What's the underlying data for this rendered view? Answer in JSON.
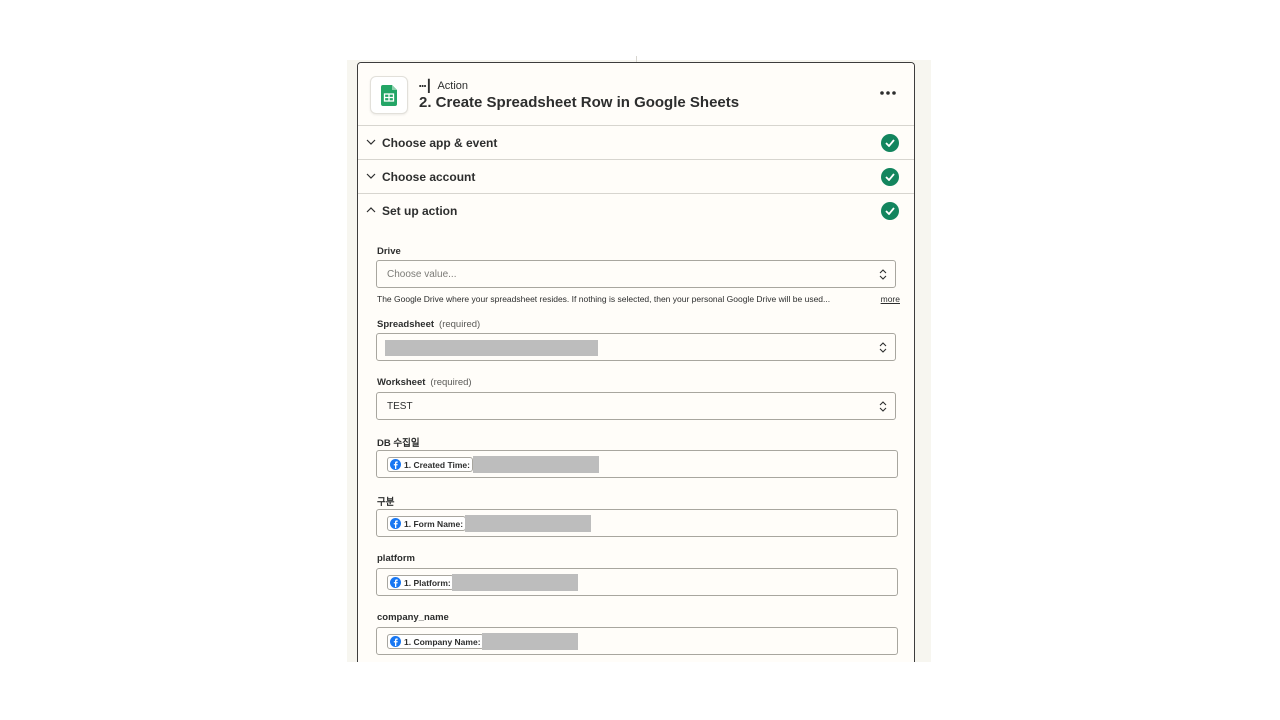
{
  "step": {
    "type_label": "Action",
    "title": "2. Create Spreadsheet Row in Google Sheets"
  },
  "sections": [
    {
      "label": "Choose app & event",
      "state": "complete"
    },
    {
      "label": "Choose account",
      "state": "complete"
    },
    {
      "label": "Set up action",
      "state": "complete"
    }
  ],
  "fields": {
    "drive": {
      "label": "Drive",
      "placeholder": "Choose value...",
      "help": "The Google Drive where your spreadsheet resides. If nothing is selected, then your personal Google Drive will be used...",
      "help_more": "more"
    },
    "spreadsheet": {
      "label": "Spreadsheet",
      "required": "(required)"
    },
    "worksheet": {
      "label": "Worksheet",
      "required": "(required)",
      "value": "TEST"
    },
    "db_date": {
      "label": "DB 수집일",
      "pill": "1. Created Time:"
    },
    "category": {
      "label": "구분",
      "pill": "1. Form Name:"
    },
    "platform": {
      "label": "platform",
      "pill": "1. Platform:"
    },
    "company_name": {
      "label": "company_name",
      "pill": "1. Company Name:"
    }
  },
  "colors": {
    "check_green": "#13855e",
    "facebook_blue": "#1877f2",
    "sheets_green": "#23a566",
    "redaction_gray": "#bdbdbd"
  },
  "icons": {
    "app": "google-sheets-icon",
    "more": "more-horizontal-icon",
    "check": "check-circle-icon",
    "facebook": "facebook-icon"
  }
}
